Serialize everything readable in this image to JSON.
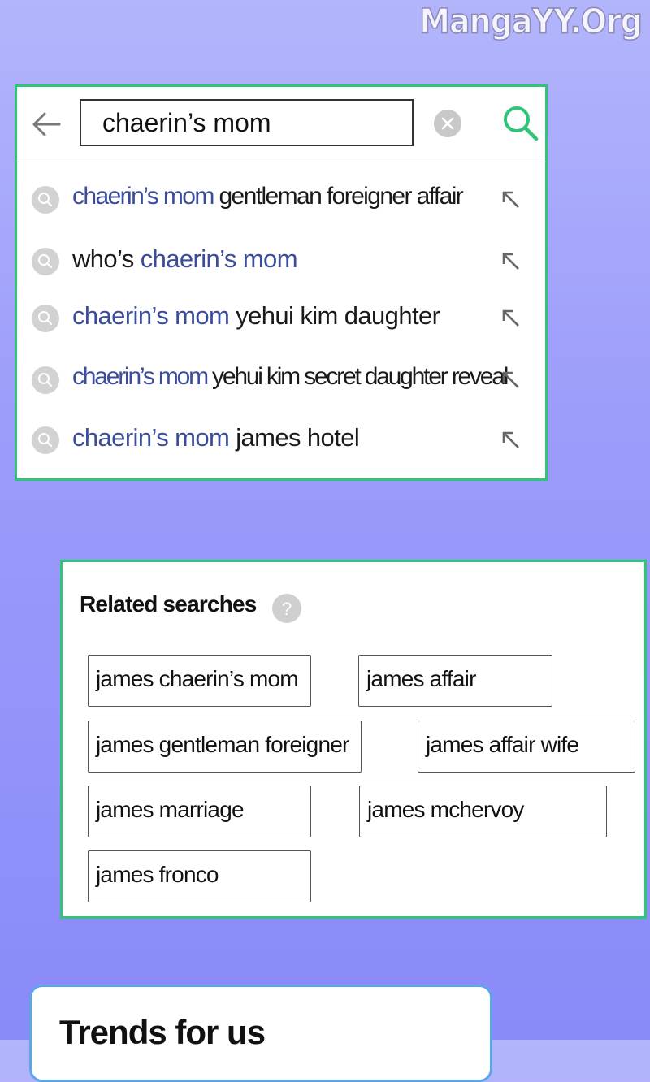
{
  "watermark": "MangaYY.Org",
  "search": {
    "query": "chaerin’s mom",
    "suggestions": [
      {
        "highlight": "chaerin’s mom",
        "rest": " gentleman foreigner affair",
        "order": "hl-first"
      },
      {
        "prefix": "who’s ",
        "highlight": "chaerin’s mom",
        "order": "prefix-first"
      },
      {
        "highlight": "chaerin’s mom",
        "rest": " yehui kim daughter",
        "order": "hl-first"
      },
      {
        "highlight": "chaerin’s mom",
        "rest": " yehui kim secret daughter reveal",
        "order": "hl-first"
      },
      {
        "highlight": "chaerin’s mom",
        "rest": " james hotel",
        "order": "hl-first"
      }
    ]
  },
  "related": {
    "title": "Related searches",
    "help": "?",
    "chips": [
      "james chaerin’s mom",
      "james affair",
      "james gentleman foreigner",
      "james affair wife",
      "james marriage",
      "james mchervoy",
      "james fronco"
    ]
  },
  "trends": {
    "title": "Trends for us"
  },
  "colors": {
    "accent_green": "#2fc47a",
    "highlight_blue": "#3b4c9c",
    "trends_border": "#5aa6ea"
  },
  "icons": [
    "back-arrow-icon",
    "clear-icon",
    "search-icon",
    "suggestion-search-icon",
    "fill-arrow-icon",
    "help-icon"
  ]
}
